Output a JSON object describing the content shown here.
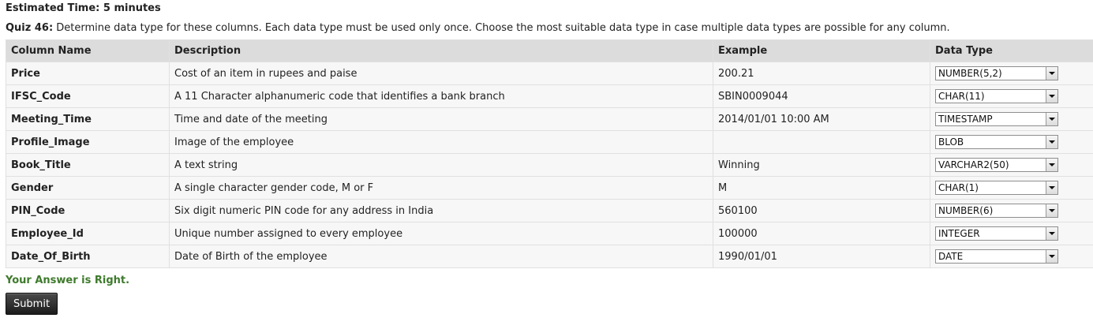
{
  "estimated_time": "Estimated Time: 5 minutes",
  "quiz": {
    "label": "Quiz 46:",
    "instruction": " Determine data type for these columns. Each data type must be used only once. Choose the most suitable data type in case multiple data types are possible for any column."
  },
  "table": {
    "headers": [
      "Column Name",
      "Description",
      "Example",
      "Data Type"
    ],
    "rows": [
      {
        "column": "Price",
        "description": "Cost of an item in rupees and paise",
        "example": "200.21",
        "data_type": "NUMBER(5,2)"
      },
      {
        "column": "IFSC_Code",
        "description": "A 11 Character alphanumeric code that identifies a bank branch",
        "example": "SBIN0009044",
        "data_type": "CHAR(11)"
      },
      {
        "column": "Meeting_Time",
        "description": "Time and date of the meeting",
        "example": "2014/01/01 10:00 AM",
        "data_type": "TIMESTAMP"
      },
      {
        "column": "Profile_Image",
        "description": "Image of the employee",
        "example": "",
        "data_type": "BLOB"
      },
      {
        "column": "Book_Title",
        "description": "A text string",
        "example": "Winning",
        "data_type": "VARCHAR2(50)"
      },
      {
        "column": "Gender",
        "description": "A single character gender code, M or F",
        "example": "M",
        "data_type": "CHAR(1)"
      },
      {
        "column": "PIN_Code",
        "description": "Six digit numeric PIN code for any address in India",
        "example": "560100",
        "data_type": "NUMBER(6)"
      },
      {
        "column": "Employee_Id",
        "description": "Unique number assigned to every employee",
        "example": "100000",
        "data_type": "INTEGER"
      },
      {
        "column": "Date_Of_Birth",
        "description": "Date of Birth of the employee",
        "example": "1990/01/01",
        "data_type": "DATE"
      }
    ]
  },
  "result_message": "Your Answer is Right.",
  "submit_label": "Submit"
}
